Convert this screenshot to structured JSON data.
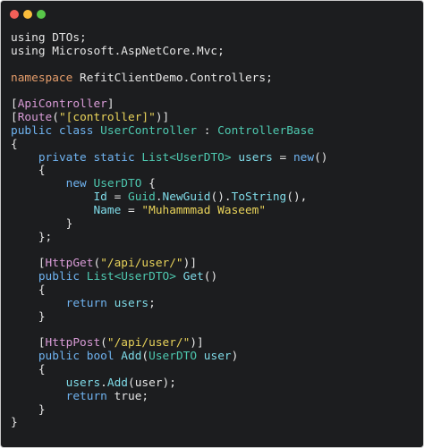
{
  "window": {
    "traffic_lights": [
      {
        "name": "close-dot",
        "color": "#f25f58"
      },
      {
        "name": "minimize-dot",
        "color": "#fbbe3c"
      },
      {
        "name": "zoom-dot",
        "color": "#58c749"
      }
    ]
  },
  "colors": {
    "plain": "#e6e6e6",
    "keyword": "#6fb3f0",
    "type": "#4ec9b0",
    "attribute": "#d89bd6",
    "string": "#e9d35a",
    "member": "#7fdbe8",
    "namespace_kw": "#e59d6b"
  },
  "code_lines": [
    [
      [
        "using DTOs;",
        "plain"
      ]
    ],
    [
      [
        "using Microsoft.AspNetCore.Mvc;",
        "plain"
      ]
    ],
    [],
    [
      [
        "namespace",
        "namespace_kw"
      ],
      [
        " RefitClientDemo.Controllers;",
        "plain"
      ]
    ],
    [],
    [
      [
        "[",
        "plain"
      ],
      [
        "ApiController",
        "attribute"
      ],
      [
        "]",
        "plain"
      ]
    ],
    [
      [
        "[",
        "plain"
      ],
      [
        "Route",
        "attribute"
      ],
      [
        "(",
        "plain"
      ],
      [
        "\"[controller]\"",
        "string"
      ],
      [
        ")]",
        "plain"
      ]
    ],
    [
      [
        "public class",
        "keyword"
      ],
      [
        " ",
        "plain"
      ],
      [
        "UserController",
        "type"
      ],
      [
        " : ",
        "plain"
      ],
      [
        "ControllerBase",
        "type"
      ]
    ],
    [
      [
        "{",
        "plain"
      ]
    ],
    [
      [
        "    ",
        "plain"
      ],
      [
        "private static",
        "keyword"
      ],
      [
        " ",
        "plain"
      ],
      [
        "List<UserDTO>",
        "type"
      ],
      [
        " ",
        "plain"
      ],
      [
        "users",
        "member"
      ],
      [
        " = ",
        "plain"
      ],
      [
        "new",
        "keyword"
      ],
      [
        "()",
        "plain"
      ]
    ],
    [
      [
        "    {",
        "plain"
      ]
    ],
    [
      [
        "        ",
        "plain"
      ],
      [
        "new",
        "keyword"
      ],
      [
        " ",
        "plain"
      ],
      [
        "UserDTO",
        "type"
      ],
      [
        " {",
        "plain"
      ]
    ],
    [
      [
        "            ",
        "plain"
      ],
      [
        "Id",
        "member"
      ],
      [
        " = ",
        "plain"
      ],
      [
        "Guid",
        "type"
      ],
      [
        ".",
        "plain"
      ],
      [
        "NewGuid",
        "member"
      ],
      [
        "().",
        "plain"
      ],
      [
        "ToString",
        "member"
      ],
      [
        "(),",
        "plain"
      ]
    ],
    [
      [
        "            ",
        "plain"
      ],
      [
        "Name",
        "member"
      ],
      [
        " = ",
        "plain"
      ],
      [
        "\"Muhammmad Waseem\"",
        "string"
      ]
    ],
    [
      [
        "        }",
        "plain"
      ]
    ],
    [
      [
        "    };",
        "plain"
      ]
    ],
    [],
    [
      [
        "    [",
        "plain"
      ],
      [
        "HttpGet",
        "attribute"
      ],
      [
        "(",
        "plain"
      ],
      [
        "\"/api/user/\"",
        "string"
      ],
      [
        ")]",
        "plain"
      ]
    ],
    [
      [
        "    ",
        "plain"
      ],
      [
        "public",
        "keyword"
      ],
      [
        " ",
        "plain"
      ],
      [
        "List<UserDTO>",
        "type"
      ],
      [
        " ",
        "plain"
      ],
      [
        "Get",
        "member"
      ],
      [
        "()",
        "plain"
      ]
    ],
    [
      [
        "    {",
        "plain"
      ]
    ],
    [
      [
        "        ",
        "plain"
      ],
      [
        "return",
        "keyword"
      ],
      [
        " ",
        "plain"
      ],
      [
        "users",
        "member"
      ],
      [
        ";",
        "plain"
      ]
    ],
    [
      [
        "    }",
        "plain"
      ]
    ],
    [],
    [
      [
        "    [",
        "plain"
      ],
      [
        "HttpPost",
        "attribute"
      ],
      [
        "(",
        "plain"
      ],
      [
        "\"/api/user/\"",
        "string"
      ],
      [
        ")]",
        "plain"
      ]
    ],
    [
      [
        "    ",
        "plain"
      ],
      [
        "public bool",
        "keyword"
      ],
      [
        " ",
        "plain"
      ],
      [
        "Add",
        "member"
      ],
      [
        "(",
        "plain"
      ],
      [
        "UserDTO",
        "type"
      ],
      [
        " ",
        "plain"
      ],
      [
        "user",
        "member"
      ],
      [
        ")",
        "plain"
      ]
    ],
    [
      [
        "    {",
        "plain"
      ]
    ],
    [
      [
        "        ",
        "plain"
      ],
      [
        "users",
        "member"
      ],
      [
        ".",
        "plain"
      ],
      [
        "Add",
        "member"
      ],
      [
        "(user);",
        "plain"
      ]
    ],
    [
      [
        "        ",
        "plain"
      ],
      [
        "return",
        "keyword"
      ],
      [
        " true;",
        "plain"
      ]
    ],
    [
      [
        "    }",
        "plain"
      ]
    ],
    [
      [
        "}",
        "plain"
      ]
    ]
  ]
}
